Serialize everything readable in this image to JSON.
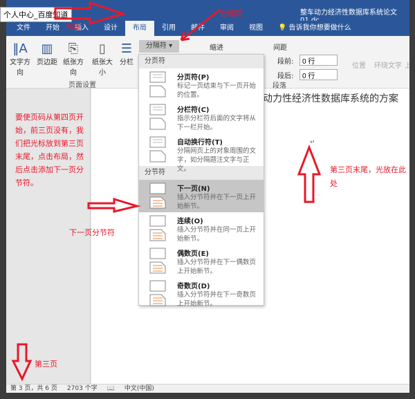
{
  "window": {
    "title": "整车动力经济性数据库系统论文01.dc"
  },
  "tooltip": "个人中心_百度知道",
  "tabs": [
    "文件",
    "开始",
    "插入",
    "设计",
    "布局",
    "引用",
    "邮件",
    "审阅",
    "视图"
  ],
  "active_tab": "布局",
  "tell_me": "告诉我你想要做什么",
  "ribbon": {
    "page_setup": {
      "buttons": [
        "文字方向",
        "页边距",
        "纸张方向",
        "纸张大小",
        "分栏"
      ],
      "group_label": "页面设置"
    },
    "breaks_button": "分隔符",
    "indent_label": "缩进",
    "spacing_label": "间距",
    "before_label": "段前:",
    "before_value": "0 行",
    "after_label": "段后:",
    "after_value": "0 行",
    "paragraph_label": "段落",
    "arrange": [
      "位置",
      "环绕文字",
      "上"
    ]
  },
  "breaks_menu": {
    "page_breaks_header": "分页符",
    "section_breaks_header": "分节符",
    "items": [
      {
        "title": "分页符(P)",
        "desc": "标记一页结束与下一页开始的位置。",
        "icon": "page-break-icon"
      },
      {
        "title": "分栏符(C)",
        "desc": "指示分栏符后面的文字将从下一栏开始。",
        "icon": "column-break-icon"
      },
      {
        "title": "自动换行符(T)",
        "desc": "分隔网页上的对象周围的文字，如分隔题注文字与正文。",
        "icon": "text-wrapping-icon"
      },
      {
        "title": "下一页(N)",
        "desc": "插入分节符并在下一页上开始新节。",
        "icon": "next-page-icon",
        "selected": true
      },
      {
        "title": "连续(O)",
        "desc": "插入分节符并在同一页上开始新节。",
        "icon": "continuous-icon"
      },
      {
        "title": "偶数页(E)",
        "desc": "插入分节符并在下一偶数页上开始新节。",
        "icon": "even-page-icon"
      },
      {
        "title": "奇数页(D)",
        "desc": "插入分节符并在下一奇数页上开始新节。",
        "icon": "odd-page-icon"
      }
    ]
  },
  "document": {
    "heading": "动力性经济性数据库系统的方案"
  },
  "annotations": {
    "layout": "布局",
    "separator": "分隔符",
    "instructions": "要使页码从第四页开始，前三页没有，我们把光标放到第三页末尾，点击布局，然后点击添加下一页分节符。",
    "next_page_break": "下一页分节符",
    "cursor_here": "第三页末尾，光放在此处",
    "page3": "第三页",
    "color": "#e8182a"
  },
  "status": {
    "page": "第 3 页，共 6 页",
    "words": "2703 个字",
    "language": "中文(中国)"
  },
  "colors": {
    "accent": "#2b579a",
    "annotation": "#e8182a"
  }
}
